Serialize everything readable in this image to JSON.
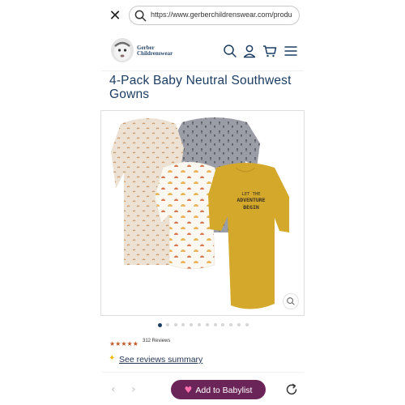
{
  "browser": {
    "url": "https://www.gerberchildrenswear.com/produ",
    "close_icon": "close-icon",
    "search_icon": "search-icon"
  },
  "header": {
    "logo_line1": "Gerber",
    "logo_line2": "Childrenswear",
    "icons": [
      "search-icon",
      "account-icon",
      "cart-icon",
      "menu-icon"
    ]
  },
  "product": {
    "title": "4-Pack Baby Neutral Southwest Gowns",
    "image_text": "LET THE ADVENTURE BEGIN",
    "gallery_count": 12,
    "gallery_active_index": 0,
    "rating_stars": "★★★★★",
    "rating_value": 5,
    "reviews_label": "312 Reviews",
    "summary_link": "See reviews summary"
  },
  "bottom_bar": {
    "prev": "‹",
    "next": "›",
    "babylist_label": "Add to Babylist",
    "heart": "♥"
  },
  "colors": {
    "brand_navy": "#1c3d63",
    "babylist_purple": "#6b2458",
    "star_orange": "#c35a2a",
    "gown_mustard": "#d4a92b",
    "gown_gray": "#8d8f98",
    "gown_beige": "#eadccb",
    "gown_white": "#fbf8f2"
  }
}
